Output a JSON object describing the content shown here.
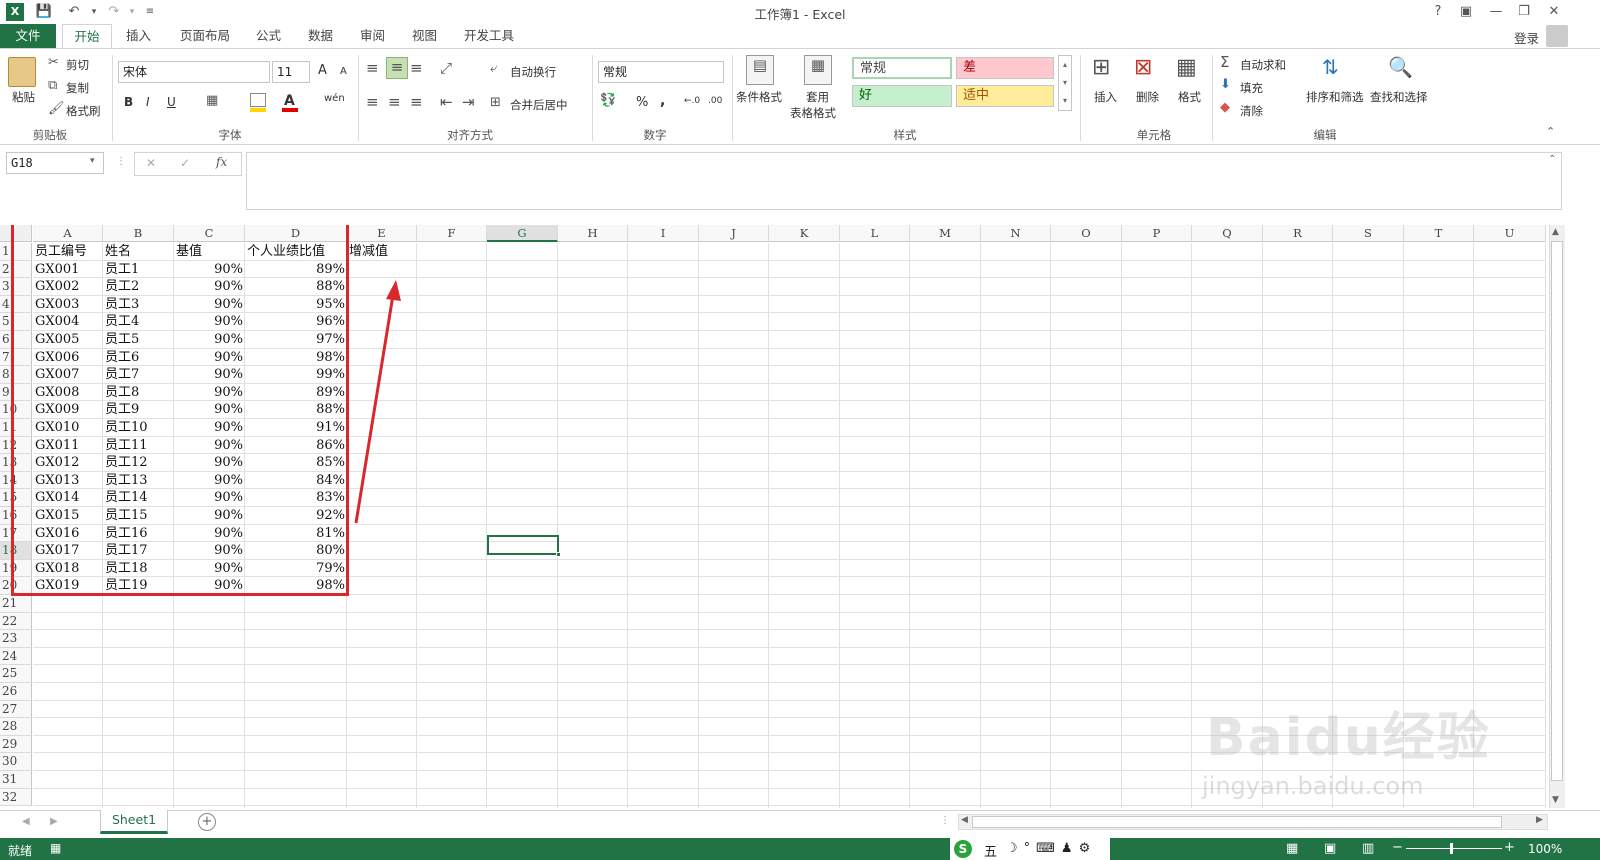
{
  "title": "工作簿1 - Excel",
  "titlebar_icons": {
    "excel": "excel-icon",
    "save": "save-icon",
    "undo": "undo-icon",
    "redo": "redo-icon"
  },
  "window_buttons": {
    "help": "?",
    "restore_ribbon": "▣",
    "minimize": "—",
    "maximize": "❐",
    "close": "✕"
  },
  "login": "登录",
  "tabs": [
    "文件",
    "开始",
    "插入",
    "页面布局",
    "公式",
    "数据",
    "审阅",
    "视图",
    "开发工具"
  ],
  "ribbon": {
    "clipboard": {
      "paste": "粘贴",
      "cut": "剪切",
      "copy": "复制",
      "format_painter": "格式刷",
      "label": "剪贴板"
    },
    "font": {
      "name": "宋体",
      "size": "11",
      "bold": "B",
      "italic": "I",
      "underline": "U",
      "label": "字体",
      "increase": "A",
      "decrease": "A",
      "wen": "wén"
    },
    "alignment": {
      "wrap": "自动换行",
      "merge": "合并后居中",
      "label": "对齐方式"
    },
    "number": {
      "format": "常规",
      "percent": "%",
      "comma": ",",
      "inc": "←.0",
      "dec": ".00",
      "label": "数字"
    },
    "styles": {
      "conditional": "条件格式",
      "table_format_1": "套用",
      "table_format_2": "表格格式",
      "normal": "常规",
      "bad": "差",
      "good": "好",
      "neutral": "适中",
      "label": "样式",
      "colors": {
        "bad_bg": "#ffc7ce",
        "bad_fg": "#9c0006",
        "good_bg": "#c6efce",
        "good_fg": "#006100",
        "neutral_bg": "#ffeb9c",
        "neutral_fg": "#9c5700"
      }
    },
    "cells": {
      "insert": "插入",
      "delete": "删除",
      "format": "格式",
      "label": "单元格"
    },
    "editing": {
      "autosum": "自动求和",
      "fill": "填充",
      "clear": "清除",
      "sort": "排序和筛选",
      "find": "查找和选择",
      "label": "编辑"
    }
  },
  "formula_bar": {
    "name_box": "G18",
    "fx": "fx",
    "value": ""
  },
  "columns": [
    "A",
    "B",
    "C",
    "D",
    "E",
    "F",
    "G",
    "H",
    "I",
    "J",
    "K",
    "L",
    "M",
    "N",
    "O",
    "P",
    "Q",
    "R",
    "S",
    "T",
    "U"
  ],
  "rows": [
    "1",
    "2",
    "3",
    "4",
    "5",
    "6",
    "7",
    "8",
    "9",
    "10",
    "11",
    "12",
    "13",
    "14",
    "15",
    "16",
    "17",
    "18",
    "19",
    "20",
    "21",
    "22",
    "23",
    "24",
    "25",
    "26",
    "27",
    "28",
    "29",
    "30",
    "31",
    "32"
  ],
  "header_row": [
    "员工编号",
    "姓名",
    "基值",
    "个人业绩比值",
    "增减值"
  ],
  "table": [
    [
      "GX001",
      "员工1",
      "90%",
      "89%"
    ],
    [
      "GX002",
      "员工2",
      "90%",
      "88%"
    ],
    [
      "GX003",
      "员工3",
      "90%",
      "95%"
    ],
    [
      "GX004",
      "员工4",
      "90%",
      "96%"
    ],
    [
      "GX005",
      "员工5",
      "90%",
      "97%"
    ],
    [
      "GX006",
      "员工6",
      "90%",
      "98%"
    ],
    [
      "GX007",
      "员工7",
      "90%",
      "99%"
    ],
    [
      "GX008",
      "员工8",
      "90%",
      "89%"
    ],
    [
      "GX009",
      "员工9",
      "90%",
      "88%"
    ],
    [
      "GX010",
      "员工10",
      "90%",
      "91%"
    ],
    [
      "GX011",
      "员工11",
      "90%",
      "86%"
    ],
    [
      "GX012",
      "员工12",
      "90%",
      "85%"
    ],
    [
      "GX013",
      "员工13",
      "90%",
      "84%"
    ],
    [
      "GX014",
      "员工14",
      "90%",
      "83%"
    ],
    [
      "GX015",
      "员工15",
      "90%",
      "92%"
    ],
    [
      "GX016",
      "员工16",
      "90%",
      "81%"
    ],
    [
      "GX017",
      "员工17",
      "90%",
      "80%"
    ],
    [
      "GX018",
      "员工18",
      "90%",
      "79%"
    ],
    [
      "GX019",
      "员工19",
      "90%",
      "98%"
    ]
  ],
  "selected_cell": "G18",
  "sheet_tab": "Sheet1",
  "status": {
    "ready": "就绪",
    "zoom": "100%",
    "ime": "五"
  },
  "watermark": {
    "text1": "Baidu经验",
    "text2": "jingyan.baidu.com"
  },
  "annotation_color": "#d9272e",
  "accent": "#217346"
}
